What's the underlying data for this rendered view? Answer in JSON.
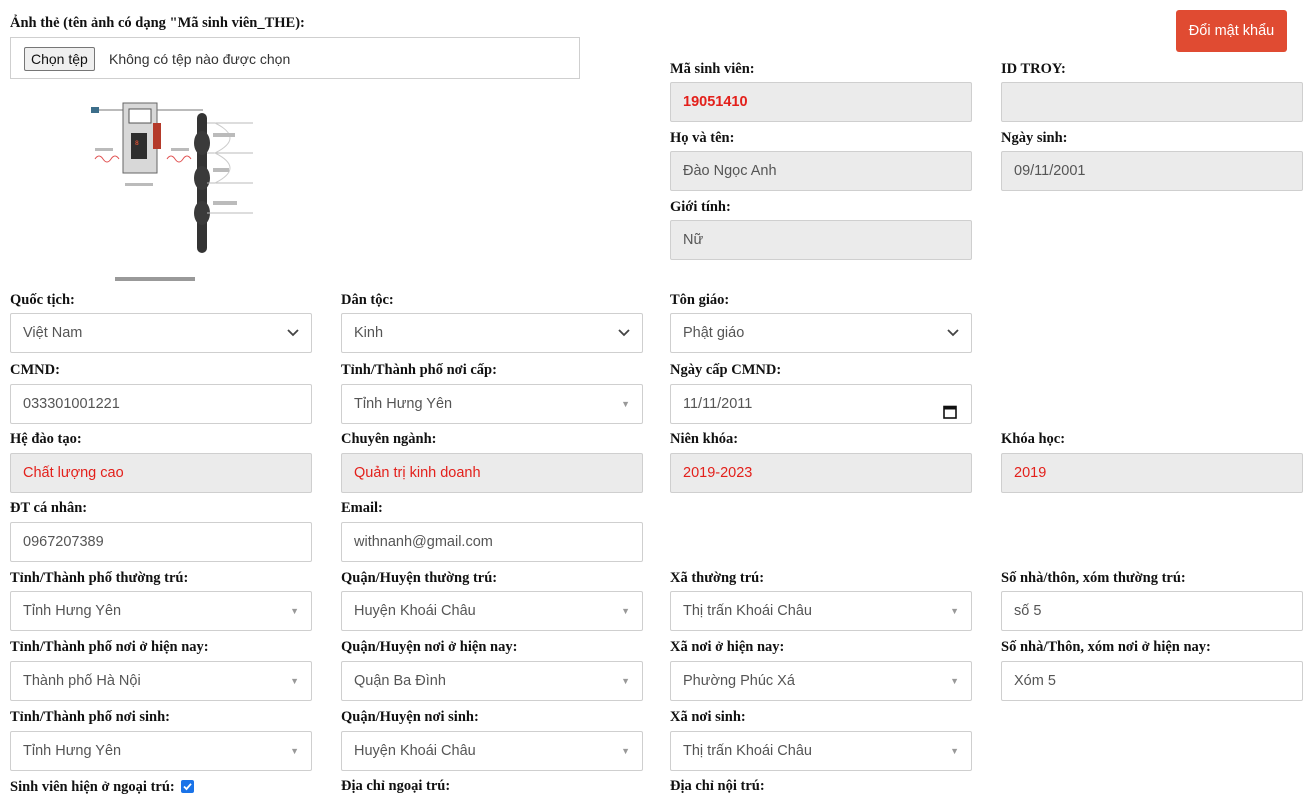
{
  "photo": {
    "label": "Ảnh thẻ (tên ảnh có dạng \"Mã sinh viên_THE):",
    "choose_button": "Chọn tệp",
    "no_file": "Không có tệp nào được chọn"
  },
  "change_password": "Đổi mật khẩu",
  "student_id": {
    "label": "Mã sinh viên:",
    "value": "19051410"
  },
  "id_troy": {
    "label": "ID TROY:",
    "value": ""
  },
  "full_name": {
    "label": "Họ và tên:",
    "value": "Đào Ngọc Anh"
  },
  "dob": {
    "label": "Ngày sinh:",
    "value": "09/11/2001"
  },
  "gender": {
    "label": "Giới tính:",
    "value": "Nữ"
  },
  "nationality": {
    "label": "Quốc tịch:",
    "value": "Việt Nam"
  },
  "ethnicity": {
    "label": "Dân tộc:",
    "value": "Kinh"
  },
  "religion": {
    "label": "Tôn giáo:",
    "value": "Phật giáo"
  },
  "id_card": {
    "label": "CMND:",
    "value": "033301001221"
  },
  "issue_province": {
    "label": "Tỉnh/Thành phố nơi cấp:",
    "value": "Tỉnh Hưng Yên"
  },
  "issue_date": {
    "label": "Ngày cấp CMND:",
    "value": "11/11/2011"
  },
  "program": {
    "label": "Hệ đào tạo:",
    "value": "Chất lượng cao"
  },
  "major": {
    "label": "Chuyên ngành:",
    "value": "Quản trị kinh doanh"
  },
  "academic_years": {
    "label": "Niên khóa:",
    "value": "2019-2023"
  },
  "cohort": {
    "label": "Khóa học:",
    "value": "2019"
  },
  "phone": {
    "label": "ĐT cá nhân:",
    "value": "0967207389"
  },
  "email": {
    "label": "Email:",
    "value": "withnanh@gmail.com"
  },
  "perm_province": {
    "label": "Tỉnh/Thành phố thường trú:",
    "value": "Tỉnh Hưng Yên"
  },
  "perm_district": {
    "label": "Quận/Huyện thường trú:",
    "value": "Huyện Khoái Châu"
  },
  "perm_commune": {
    "label": "Xã thường trú:",
    "value": "Thị trấn Khoái Châu"
  },
  "perm_house": {
    "label": "Số nhà/thôn, xóm thường trú:",
    "value": "số 5"
  },
  "cur_province": {
    "label": "Tỉnh/Thành phố nơi ở hiện nay:",
    "value": "Thành phố Hà Nội"
  },
  "cur_district": {
    "label": "Quận/Huyện nơi ở hiện nay:",
    "value": "Quận Ba Đình"
  },
  "cur_commune": {
    "label": "Xã nơi ở hiện nay:",
    "value": "Phường Phúc Xá"
  },
  "cur_house": {
    "label": "Số nhà/Thôn, xóm nơi ở hiện nay:",
    "value": "Xóm 5"
  },
  "birth_province": {
    "label": "Tỉnh/Thành phố nơi sinh:",
    "value": "Tỉnh Hưng Yên"
  },
  "birth_district": {
    "label": "Quận/Huyện nơi sinh:",
    "value": "Huyện Khoái Châu"
  },
  "birth_commune": {
    "label": "Xã nơi sinh:",
    "value": "Thị trấn Khoái Châu"
  },
  "offcampus": {
    "label": "Sinh viên hiện ở ngoại trú:",
    "checked": true
  },
  "offcampus_address": {
    "label": "Địa chỉ ngoại trú:"
  },
  "dorm_address": {
    "label": "Địa chỉ nội trú:"
  },
  "colors": {
    "accent_red": "#e04b32",
    "value_red": "#e3201b",
    "readonly_bg": "#ebebeb",
    "checkbox_blue": "#1a73e8"
  }
}
